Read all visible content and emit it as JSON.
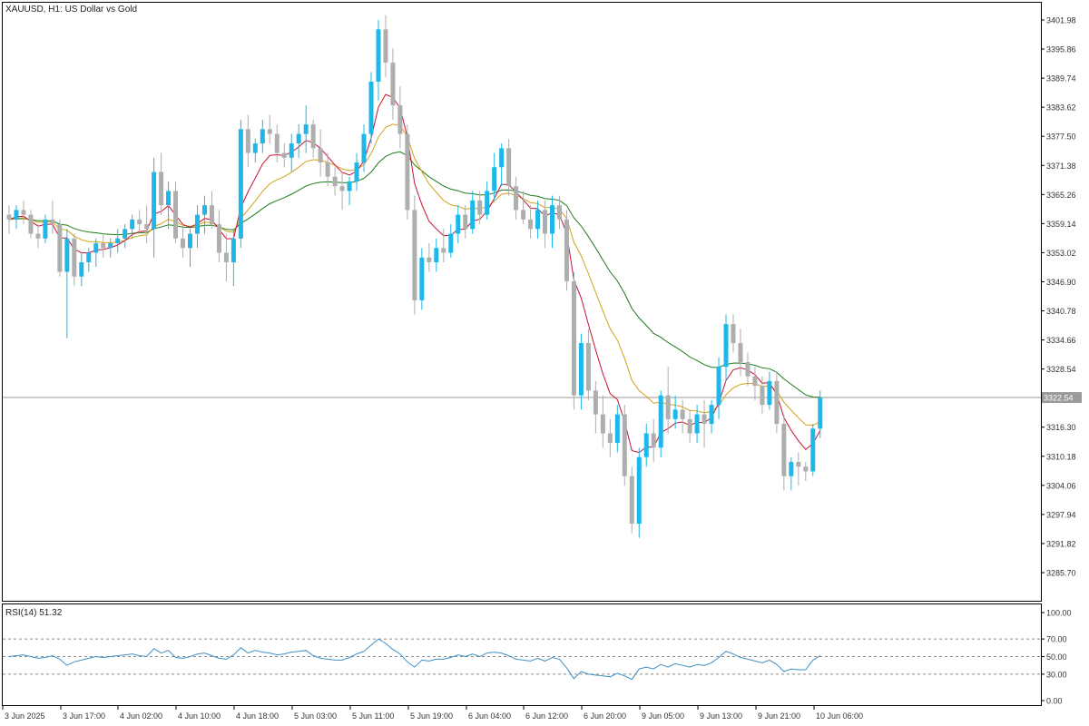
{
  "window": {
    "title": "XAUUSD, H1:  US Dollar vs Gold"
  },
  "price_tag": "3322.54",
  "rsi_title": "RSI(14) 51.32",
  "colors": {
    "bull": "#1EB7EA",
    "bear": "#AEAEAE",
    "ma_fast": "#C8102E",
    "ma_mid": "#D4A017",
    "ma_slow": "#1E7B1E",
    "rsi_line": "#3F8FC6",
    "grid_dash": "#888888",
    "axis": "#000000",
    "price_line": "#9A9A9A"
  },
  "chart_data": [
    {
      "type": "candlestick",
      "title": "XAUUSD, H1:  US Dollar vs Gold",
      "xlabel": "",
      "ylabel": "",
      "ylim": [
        3282,
        3405
      ],
      "y_ticks": [
        "3401.98",
        "3395.86",
        "3389.74",
        "3383.62",
        "3377.50",
        "3371.38",
        "3365.26",
        "3359.14",
        "3353.02",
        "3346.90",
        "3340.78",
        "3334.66",
        "3328.54",
        "3322.54",
        "3316.30",
        "3310.18",
        "3304.06",
        "3297.94",
        "3291.82",
        "3285.70"
      ],
      "x_tick_labels": [
        "3 Jun 2025",
        "3 Jun 17:00",
        "4 Jun 02:00",
        "4 Jun 10:00",
        "4 Jun 18:00",
        "5 Jun 03:00",
        "5 Jun 11:00",
        "5 Jun 19:00",
        "6 Jun 04:00",
        "6 Jun 12:00",
        "6 Jun 20:00",
        "9 Jun 05:00",
        "9 Jun 13:00",
        "9 Jun 21:00",
        "10 Jun 06:00"
      ],
      "last_price": 3322.54,
      "series": [
        {
          "name": "",
          "ohlc": [
            [
              3361,
              3363,
              3357,
              3360
            ],
            [
              3360,
              3363,
              3358,
              3362
            ],
            [
              3362,
              3364,
              3359,
              3361
            ],
            [
              3361,
              3362,
              3356,
              3357
            ],
            [
              3357,
              3359,
              3354,
              3356
            ],
            [
              3356,
              3361,
              3355,
              3360
            ],
            [
              3360,
              3364,
              3357,
              3359
            ],
            [
              3359,
              3360,
              3348,
              3349
            ],
            [
              3349,
              3358,
              3335,
              3356
            ],
            [
              3356,
              3357,
              3346,
              3348
            ],
            [
              3348,
              3353,
              3346,
              3351
            ],
            [
              3351,
              3354,
              3349,
              3353
            ],
            [
              3353,
              3356,
              3350,
              3355
            ],
            [
              3355,
              3357,
              3352,
              3354
            ],
            [
              3354,
              3356,
              3352,
              3355
            ],
            [
              3355,
              3358,
              3353,
              3356
            ],
            [
              3356,
              3359,
              3354,
              3358
            ],
            [
              3358,
              3361,
              3356,
              3360
            ],
            [
              3360,
              3362,
              3357,
              3359
            ],
            [
              3359,
              3363,
              3355,
              3358
            ],
            [
              3358,
              3373,
              3352,
              3370
            ],
            [
              3370,
              3374,
              3361,
              3363
            ],
            [
              3363,
              3368,
              3358,
              3366
            ],
            [
              3366,
              3368,
              3355,
              3356
            ],
            [
              3356,
              3359,
              3352,
              3354
            ],
            [
              3354,
              3358,
              3350,
              3357
            ],
            [
              3357,
              3363,
              3354,
              3361
            ],
            [
              3361,
              3365,
              3357,
              3363
            ],
            [
              3363,
              3366,
              3358,
              3359
            ],
            [
              3359,
              3362,
              3351,
              3353
            ],
            [
              3353,
              3357,
              3347,
              3351
            ],
            [
              3351,
              3358,
              3346,
              3356
            ],
            [
              3356,
              3381,
              3354,
              3379
            ],
            [
              3379,
              3382,
              3371,
              3374
            ],
            [
              3374,
              3377,
              3372,
              3376
            ],
            [
              3376,
              3381,
              3374,
              3379
            ],
            [
              3379,
              3382,
              3376,
              3378
            ],
            [
              3378,
              3380,
              3372,
              3374
            ],
            [
              3374,
              3376,
              3371,
              3373
            ],
            [
              3373,
              3378,
              3370,
              3376
            ],
            [
              3376,
              3380,
              3373,
              3378
            ],
            [
              3378,
              3384,
              3374,
              3380
            ],
            [
              3380,
              3381,
              3373,
              3375
            ],
            [
              3375,
              3379,
              3369,
              3372
            ],
            [
              3372,
              3374,
              3367,
              3369
            ],
            [
              3369,
              3371,
              3365,
              3367
            ],
            [
              3367,
              3370,
              3362,
              3366
            ],
            [
              3366,
              3369,
              3363,
              3368
            ],
            [
              3368,
              3374,
              3366,
              3372
            ],
            [
              3372,
              3380,
              3370,
              3378
            ],
            [
              3378,
              3391,
              3376,
              3389
            ],
            [
              3389,
              3402,
              3385,
              3400
            ],
            [
              3400,
              3403,
              3390,
              3393
            ],
            [
              3393,
              3396,
              3381,
              3384
            ],
            [
              3384,
              3388,
              3375,
              3378
            ],
            [
              3378,
              3380,
              3360,
              3362
            ],
            [
              3362,
              3365,
              3340,
              3343
            ],
            [
              3343,
              3354,
              3341,
              3352
            ],
            [
              3352,
              3355,
              3349,
              3351
            ],
            [
              3351,
              3356,
              3349,
              3354
            ],
            [
              3354,
              3358,
              3351,
              3353
            ],
            [
              3353,
              3359,
              3352,
              3357
            ],
            [
              3357,
              3363,
              3355,
              3361
            ],
            [
              3361,
              3363,
              3356,
              3358
            ],
            [
              3358,
              3366,
              3357,
              3364
            ],
            [
              3364,
              3366,
              3359,
              3361
            ],
            [
              3361,
              3368,
              3360,
              3366
            ],
            [
              3366,
              3374,
              3364,
              3371
            ],
            [
              3371,
              3376,
              3367,
              3375
            ],
            [
              3375,
              3377,
              3365,
              3367
            ],
            [
              3367,
              3369,
              3360,
              3362
            ],
            [
              3362,
              3366,
              3359,
              3360
            ],
            [
              3360,
              3363,
              3356,
              3358
            ],
            [
              3358,
              3364,
              3356,
              3362
            ],
            [
              3362,
              3364,
              3354,
              3357
            ],
            [
              3357,
              3365,
              3354,
              3363
            ],
            [
              3363,
              3365,
              3358,
              3360
            ],
            [
              3360,
              3362,
              3345,
              3347
            ],
            [
              3347,
              3349,
              3320,
              3323
            ],
            [
              3323,
              3336,
              3320,
              3334
            ],
            [
              3334,
              3337,
              3322,
              3324
            ],
            [
              3324,
              3326,
              3315,
              3319
            ],
            [
              3319,
              3323,
              3312,
              3315
            ],
            [
              3315,
              3318,
              3310,
              3313
            ],
            [
              3313,
              3321,
              3311,
              3319
            ],
            [
              3319,
              3321,
              3304,
              3306
            ],
            [
              3306,
              3308,
              3294,
              3296
            ],
            [
              3296,
              3312,
              3293,
              3310
            ],
            [
              3310,
              3317,
              3308,
              3315
            ],
            [
              3315,
              3318,
              3309,
              3312
            ],
            [
              3312,
              3324,
              3310,
              3323
            ],
            [
              3323,
              3329,
              3315,
              3318
            ],
            [
              3318,
              3323,
              3316,
              3320
            ],
            [
              3320,
              3322,
              3315,
              3318
            ],
            [
              3318,
              3320,
              3313,
              3315
            ],
            [
              3315,
              3321,
              3313,
              3319
            ],
            [
              3319,
              3322,
              3312,
              3317
            ],
            [
              3317,
              3322,
              3315,
              3321
            ],
            [
              3321,
              3331,
              3318,
              3329
            ],
            [
              3329,
              3340,
              3326,
              3338
            ],
            [
              3338,
              3340,
              3332,
              3334
            ],
            [
              3334,
              3337,
              3327,
              3330
            ],
            [
              3330,
              3332,
              3325,
              3327
            ],
            [
              3327,
              3329,
              3322,
              3325
            ],
            [
              3325,
              3327,
              3319,
              3321
            ],
            [
              3321,
              3328,
              3320,
              3326
            ],
            [
              3326,
              3328,
              3315,
              3317
            ],
            [
              3317,
              3319,
              3303,
              3306
            ],
            [
              3306,
              3310,
              3303,
              3309
            ],
            [
              3309,
              3311,
              3304,
              3308
            ],
            [
              3308,
              3309,
              3305,
              3307
            ],
            [
              3307,
              3317,
              3306,
              3316
            ],
            [
              3316,
              3324,
              3314,
              3322.54
            ]
          ]
        }
      ]
    },
    {
      "type": "line",
      "title": "RSI(14) 51.32",
      "xlabel": "",
      "ylabel": "",
      "ylim": [
        0,
        100
      ],
      "y_ticks": [
        "100.00",
        "70.00",
        "50.00",
        "30.00",
        "0.00"
      ],
      "series": [
        {
          "name": "",
          "values": [
            50,
            51,
            52,
            50,
            48,
            49,
            51,
            47,
            40,
            44,
            46,
            48,
            50,
            49,
            50,
            51,
            52,
            53,
            51,
            50,
            59,
            54,
            57,
            49,
            48,
            50,
            53,
            54,
            51,
            48,
            47,
            52,
            60,
            54,
            57,
            55,
            54,
            52,
            53,
            55,
            56,
            57,
            51,
            48,
            47,
            46,
            46,
            49,
            53,
            56,
            63,
            70,
            65,
            58,
            53,
            44,
            38,
            46,
            45,
            47,
            47,
            49,
            52,
            50,
            53,
            50,
            54,
            55,
            54,
            51,
            47,
            46,
            45,
            48,
            45,
            49,
            47,
            37,
            25,
            33,
            30,
            29,
            28,
            27,
            31,
            28,
            24,
            36,
            38,
            36,
            41,
            38,
            42,
            40,
            38,
            41,
            40,
            43,
            49,
            56,
            53,
            49,
            47,
            45,
            43,
            46,
            41,
            33,
            36,
            35,
            35,
            46,
            51
          ]
        }
      ]
    }
  ]
}
